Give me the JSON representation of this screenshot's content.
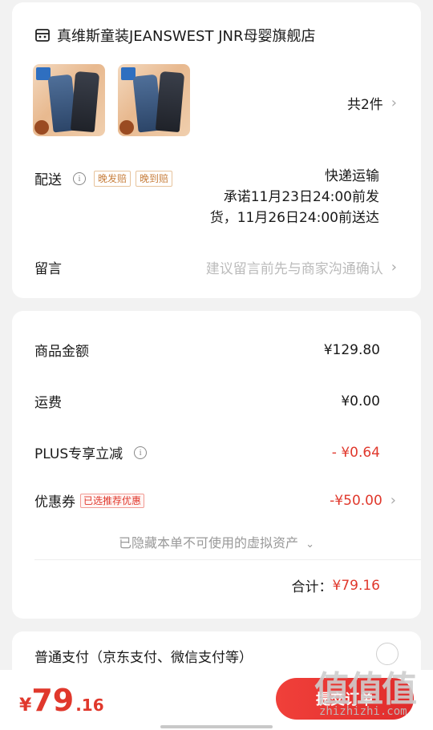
{
  "store": {
    "name": "真维斯童装JEANSWEST JNR母婴旗舰店",
    "item_count": "共2件",
    "delivery_label": "配送",
    "badges": [
      "晚发赔",
      "晚到赔"
    ],
    "shipping_method": "快递运输",
    "promise_line1": "承诺11月23日24:00前发",
    "promise_line2": "货，11月26日24:00前送达",
    "note_label": "留言",
    "note_placeholder": "建议留言前先与商家沟通确认"
  },
  "prices": {
    "goods_label": "商品金额",
    "goods_value": "¥129.80",
    "freight_label": "运费",
    "freight_value": "¥0.00",
    "plus_label": "PLUS专享立减",
    "plus_value": "- ¥0.64",
    "coupon_label": "优惠券",
    "coupon_badge": "已选推荐优惠",
    "coupon_value": "-¥50.00",
    "hidden_assets": "已隐藏本单不可使用的虚拟资产",
    "total_label": "合计：",
    "total_value": "¥79.16"
  },
  "payment": {
    "method_label": "普通支付（京东支付、微信支付等）"
  },
  "bottom": {
    "yen": "¥",
    "amount_int": "79",
    "amount_dec": ".16",
    "pay_button": "提交订单"
  },
  "watermark": {
    "text": "值值值",
    "url": "zhizhizhi.com"
  },
  "colors": {
    "accent_red": "#e0382c",
    "badge_orange": "#c8803f",
    "background": "#f2f2f2"
  }
}
